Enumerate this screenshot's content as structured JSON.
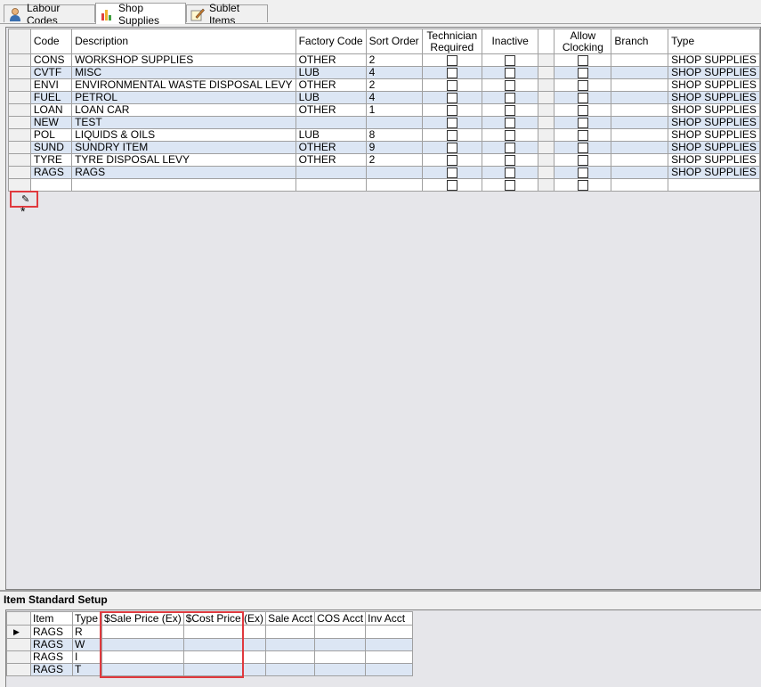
{
  "tabs": [
    {
      "label": "Labour Codes",
      "icon": "person-icon"
    },
    {
      "label": "Shop Supplies",
      "icon": "bar-chart-icon"
    },
    {
      "label": "Sublet Items",
      "icon": "note-pencil-icon"
    }
  ],
  "grid": {
    "headers": [
      "Code",
      "Description",
      "Factory Code",
      "Sort Order",
      "Technician Required",
      "Inactive",
      "Allow Clocking",
      "Branch",
      "Type"
    ],
    "header_lines": {
      "technician": [
        "Technician",
        "Required"
      ],
      "allow": [
        "Allow",
        "Clocking"
      ]
    },
    "rows": [
      {
        "code": "CONS",
        "description": "WORKSHOP SUPPLIES",
        "factory_code": "OTHER",
        "sort_order": "2",
        "type": "SHOP SUPPLIES"
      },
      {
        "code": "CVTF",
        "description": "MISC",
        "factory_code": "LUB",
        "sort_order": "4",
        "type": "SHOP SUPPLIES"
      },
      {
        "code": "ENVI",
        "description": "ENVIRONMENTAL WASTE DISPOSAL LEVY",
        "factory_code": "OTHER",
        "sort_order": "2",
        "type": "SHOP SUPPLIES"
      },
      {
        "code": "FUEL",
        "description": "PETROL",
        "factory_code": "LUB",
        "sort_order": "4",
        "type": "SHOP SUPPLIES"
      },
      {
        "code": "LOAN",
        "description": "LOAN CAR",
        "factory_code": "OTHER",
        "sort_order": "1",
        "type": "SHOP SUPPLIES"
      },
      {
        "code": "NEW",
        "description": "TEST",
        "factory_code": "",
        "sort_order": "",
        "type": "SHOP SUPPLIES"
      },
      {
        "code": "POL",
        "description": "LIQUIDS & OILS",
        "factory_code": "LUB",
        "sort_order": "8",
        "type": "SHOP SUPPLIES"
      },
      {
        "code": "SUND",
        "description": "SUNDRY ITEM",
        "factory_code": "OTHER",
        "sort_order": "9",
        "type": "SHOP SUPPLIES"
      },
      {
        "code": "TYRE",
        "description": "TYRE DISPOSAL LEVY",
        "factory_code": "OTHER",
        "sort_order": "2",
        "type": "SHOP SUPPLIES"
      },
      {
        "code": "RAGS",
        "description": "RAGS",
        "factory_code": "",
        "sort_order": "",
        "type": "SHOP SUPPLIES"
      }
    ],
    "edit_indicator": "✎",
    "new_row_indicator": "*"
  },
  "standard_setup": {
    "title": "Item Standard Setup",
    "headers": [
      "Item",
      "Type",
      "$Sale Price (Ex)",
      "$Cost Price (Ex)",
      "Sale Acct",
      "COS Acct",
      "Inv Acct"
    ],
    "rows": [
      {
        "item": "RAGS",
        "type": "R"
      },
      {
        "item": "RAGS",
        "type": "W"
      },
      {
        "item": "RAGS",
        "type": "I"
      },
      {
        "item": "RAGS",
        "type": "T"
      }
    ],
    "current_row_indicator": "▶"
  },
  "colors": {
    "highlight": "#e0393e",
    "row_alt": "#dce6f4",
    "grid_bg": "#e6e6ea"
  }
}
